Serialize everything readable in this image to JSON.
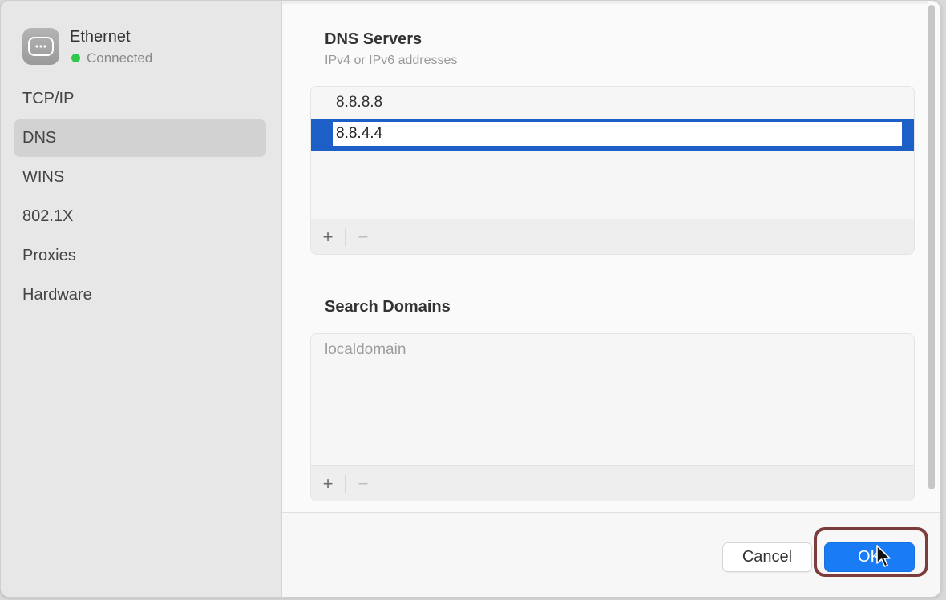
{
  "interface": {
    "name": "Ethernet",
    "status": "Connected",
    "status_color": "#2ec94a",
    "icon": "ethernet-icon"
  },
  "sidebar": {
    "items": [
      {
        "label": "TCP/IP",
        "active": false
      },
      {
        "label": "DNS",
        "active": true
      },
      {
        "label": "WINS",
        "active": false
      },
      {
        "label": "802.1X",
        "active": false
      },
      {
        "label": "Proxies",
        "active": false
      },
      {
        "label": "Hardware",
        "active": false
      }
    ]
  },
  "dns_servers": {
    "title": "DNS Servers",
    "subtitle": "IPv4 or IPv6 addresses",
    "entries": [
      "8.8.8.8",
      "8.8.4.4"
    ],
    "selected_index": 1,
    "add_label": "+",
    "remove_label": "−"
  },
  "search_domains": {
    "title": "Search Domains",
    "placeholder": "localdomain",
    "add_label": "+",
    "remove_label": "−"
  },
  "footer": {
    "cancel_label": "Cancel",
    "ok_label": "OK"
  },
  "colors": {
    "accent": "#1a7cf4",
    "selection": "#1b5fc7",
    "highlight": "#7d3c3c"
  }
}
